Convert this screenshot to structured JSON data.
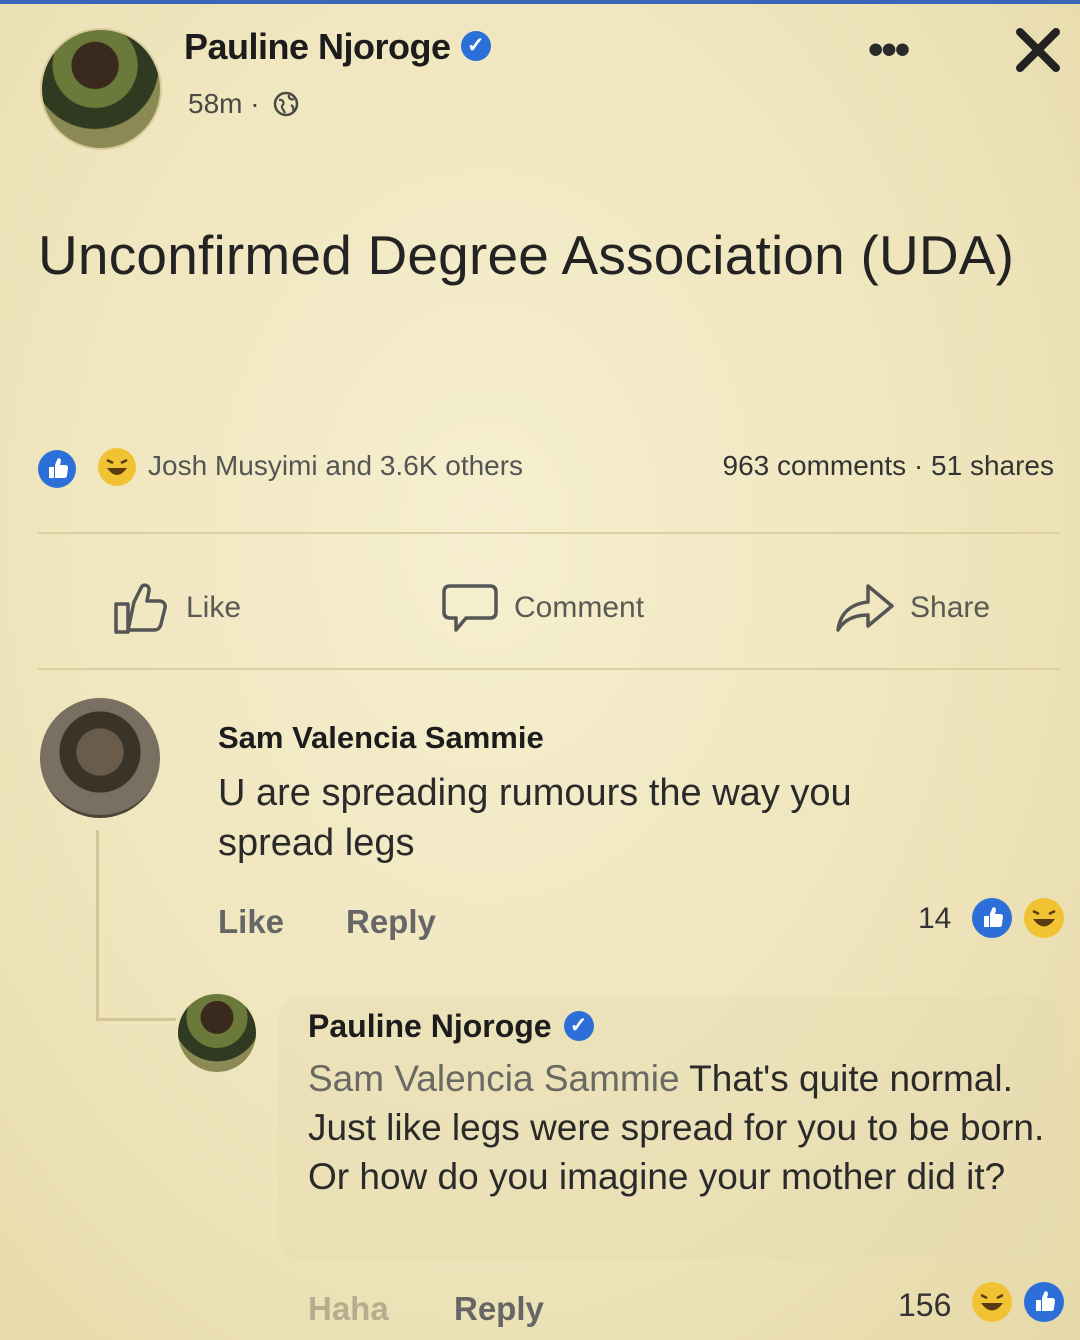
{
  "post": {
    "author": "Pauline Njoroge",
    "time": "58m",
    "text": "Unconfirmed Degree Association (UDA)",
    "reactors": "Josh Musyimi and 3.6K others",
    "counts": "963 comments · 51 shares"
  },
  "actions": {
    "like": "Like",
    "comment": "Comment",
    "share": "Share"
  },
  "comments": [
    {
      "author": "Sam Valencia Sammie",
      "text": "U are spreading rumours the way you spread legs",
      "like_label": "Like",
      "reply_label": "Reply",
      "reaction_count": "14"
    }
  ],
  "reply": {
    "author": "Pauline Njoroge",
    "mention": "Sam Valencia Sammie",
    "text": " That's quite normal. Just  like legs were spread for you to be born. Or how do you imagine your mother did it?",
    "haha_label": "Haha",
    "reply_label": "Reply",
    "reaction_count": "156"
  },
  "colors": {
    "verified": "#2d6fd9",
    "like_reaction": "#2d6fd9",
    "haha_reaction": "#f1c232",
    "background": "#f3ebc8"
  },
  "icons": [
    "verified-icon",
    "globe-icon",
    "more-icon",
    "close-icon",
    "like-icon",
    "comment-icon",
    "share-icon"
  ]
}
